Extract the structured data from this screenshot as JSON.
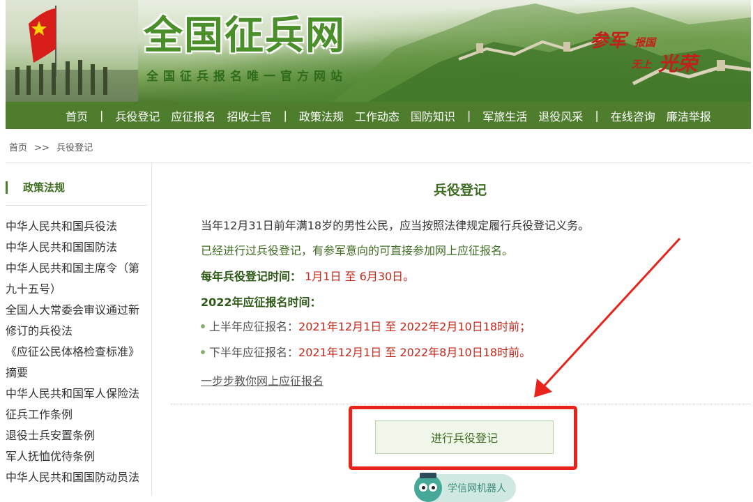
{
  "header": {
    "logo_text": "全国征兵网",
    "slogan": "全国征兵报名唯一官方网站",
    "motto": [
      "参军",
      "报国",
      "无上",
      "光荣"
    ]
  },
  "nav": {
    "items": [
      "首页",
      "兵役登记",
      "应征报名",
      "招收士官",
      "政策法规",
      "工作动态",
      "国防知识",
      "军旅生活",
      "退役风采",
      "在线咨询",
      "廉洁举报"
    ],
    "separator": "|"
  },
  "breadcrumb": {
    "home": "首页",
    "separator": ">>",
    "current": "兵役登记"
  },
  "sidebar": {
    "title": "政策法规",
    "items": [
      "中华人民共和国兵役法",
      "中华人民共和国国防法",
      "中华人民共和国主席令（第",
      "九十五号）",
      "全国人大常委会审议通过新",
      "修订的兵役法",
      "《应征公民体格检查标准》",
      "摘要",
      "中华人民共和国军人保险法",
      "征兵工作条例",
      "退役士兵安置条例",
      "军人抚恤优待条例",
      "中华人民共和国国防动员法"
    ]
  },
  "main": {
    "title": "兵役登记",
    "para1": "当年12月31日前年满18岁的男性公民，应当按照法律规定履行兵役登记义务。",
    "para2": "已经进行过兵役登记，有参军意向的可直接参加网上应征报名。",
    "reg_time_label": "每年兵役登记时间：",
    "reg_time_value": "1月1日 至 6月30日。",
    "enroll_title": "2022年应征报名时间：",
    "first_half_label": "上半年应征报名：",
    "first_half_value": "2021年12月1日 至 2022年2月10日18时前；",
    "second_half_label": "下半年应征报名：",
    "second_half_value": "2021年12月1日 至 2022年8月10日18时前。",
    "guide_link": "一步步教你网上应征报名",
    "register_button": "进行兵役登记"
  },
  "robot": {
    "label": "学信网机器人"
  },
  "colors": {
    "brand_green": "#4e7d2d",
    "highlight_red": "#e8231b",
    "date_red": "#c4271a"
  }
}
